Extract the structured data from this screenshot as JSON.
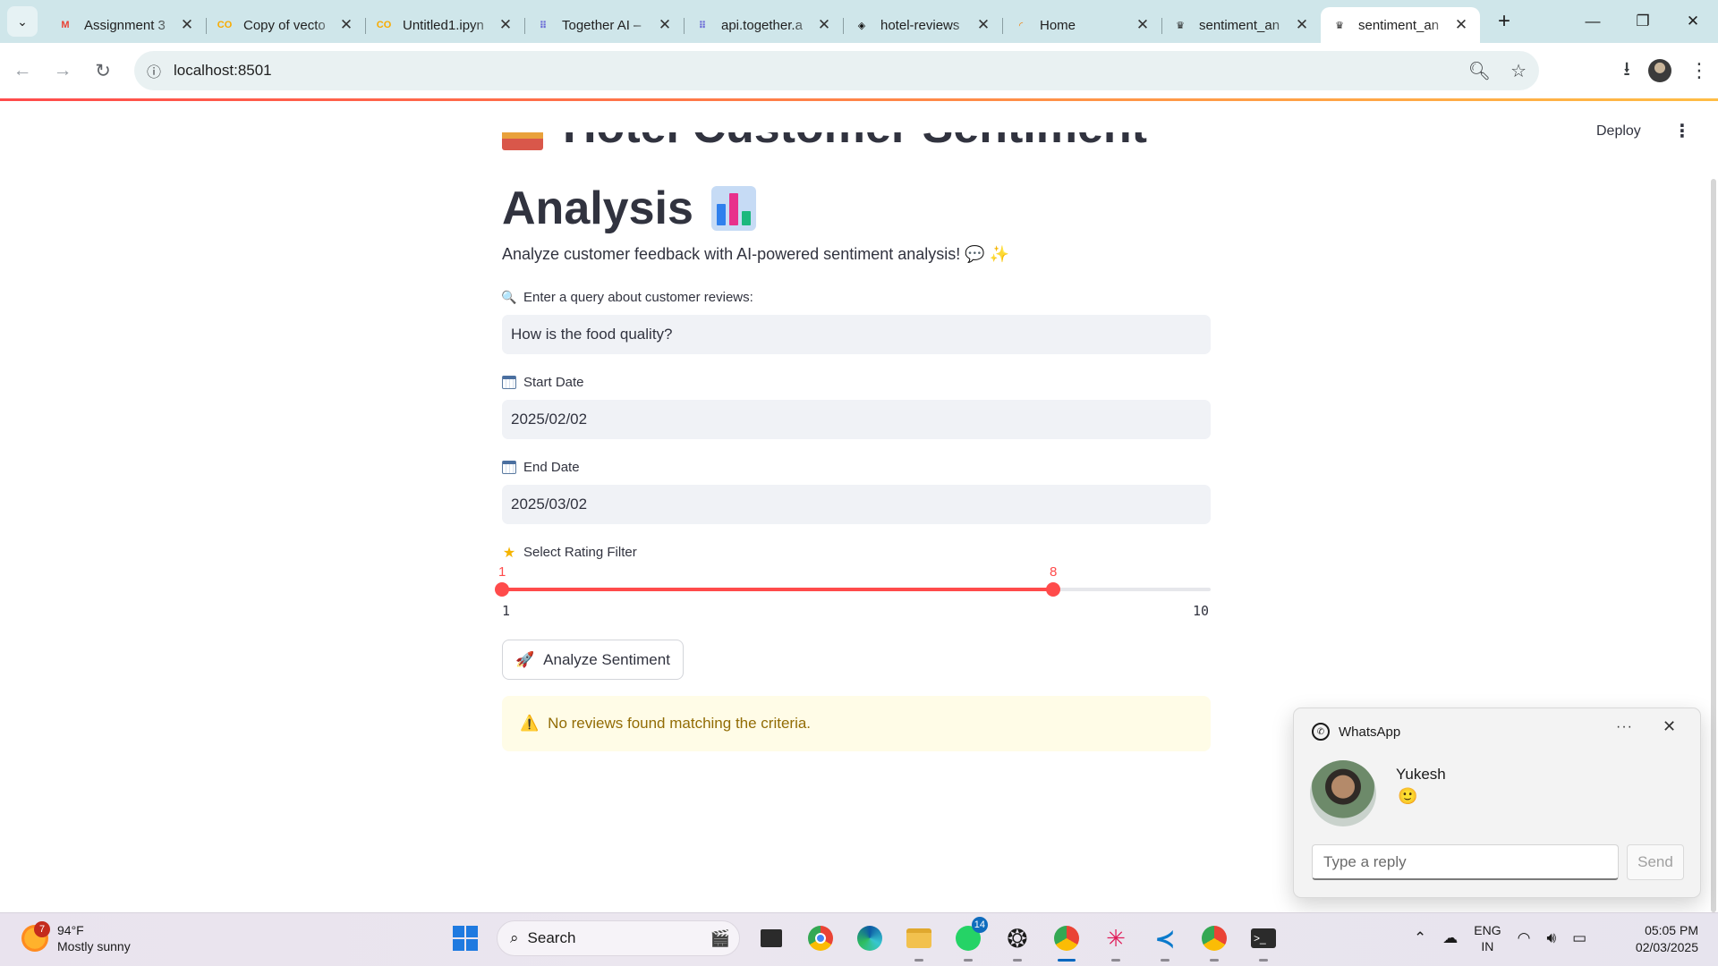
{
  "browser": {
    "tabs": [
      {
        "title": "Assignment 3",
        "favicon": "gmail-icon",
        "fav_color": "#ea4335",
        "fav_text": "M"
      },
      {
        "title": "Copy of vecto",
        "favicon": "colab-icon",
        "fav_color": "#f9ab00",
        "fav_text": "CO"
      },
      {
        "title": "Untitled1.ipyn",
        "favicon": "colab-icon",
        "fav_color": "#f9ab00",
        "fav_text": "CO"
      },
      {
        "title": "Together AI – ",
        "favicon": "together-icon",
        "fav_color": "#6b6bd6",
        "fav_text": "⠿"
      },
      {
        "title": "api.together.a",
        "favicon": "together-icon",
        "fav_color": "#6b6bd6",
        "fav_text": "⠿"
      },
      {
        "title": "hotel-reviews",
        "favicon": "hotel-reviews-icon",
        "fav_color": "#111111",
        "fav_text": "◈"
      },
      {
        "title": "Home",
        "favicon": "loading-icon",
        "fav_color": "#f57c00",
        "fav_text": "◜"
      },
      {
        "title": "sentiment_an",
        "favicon": "streamlit-icon",
        "fav_color": "#222222",
        "fav_text": "♛"
      },
      {
        "title": "sentiment_an",
        "favicon": "streamlit-icon",
        "fav_color": "#222222",
        "fav_text": "♛",
        "active": true
      }
    ],
    "url": "localhost:8501"
  },
  "app": {
    "deploy_label": "Deploy",
    "title_line1": "Hotel Customer Sentiment",
    "title_line2": "Analysis",
    "subtitle": "Analyze customer feedback with AI-powered sentiment analysis! 💬 ✨",
    "query": {
      "label": "Enter a query about customer reviews:",
      "value": "How is the food quality?"
    },
    "start_date": {
      "label": "Start Date",
      "value": "2025/02/02"
    },
    "end_date": {
      "label": "End Date",
      "value": "2025/03/02"
    },
    "rating_filter": {
      "label": "Select Rating Filter",
      "min": 1,
      "max": 10,
      "low": 1,
      "high": 8,
      "min_label": "1",
      "max_label": "10",
      "low_label": "1",
      "high_label": "8"
    },
    "analyze_button": "Analyze Sentiment",
    "warning": "No reviews found matching the criteria.",
    "accent_color": "#ff4b4b"
  },
  "notification": {
    "app_name": "WhatsApp",
    "sender": "Yukesh",
    "message": "🙂",
    "reply_placeholder": "Type a reply",
    "send_label": "Send"
  },
  "taskbar": {
    "weather_temp": "94°F",
    "weather_desc": "Mostly sunny",
    "weather_badge": "7",
    "search_label": "Search",
    "whatsapp_badge": "14",
    "lang_line1": "ENG",
    "lang_line2": "IN",
    "time": "05:05 PM",
    "date": "02/03/2025"
  }
}
